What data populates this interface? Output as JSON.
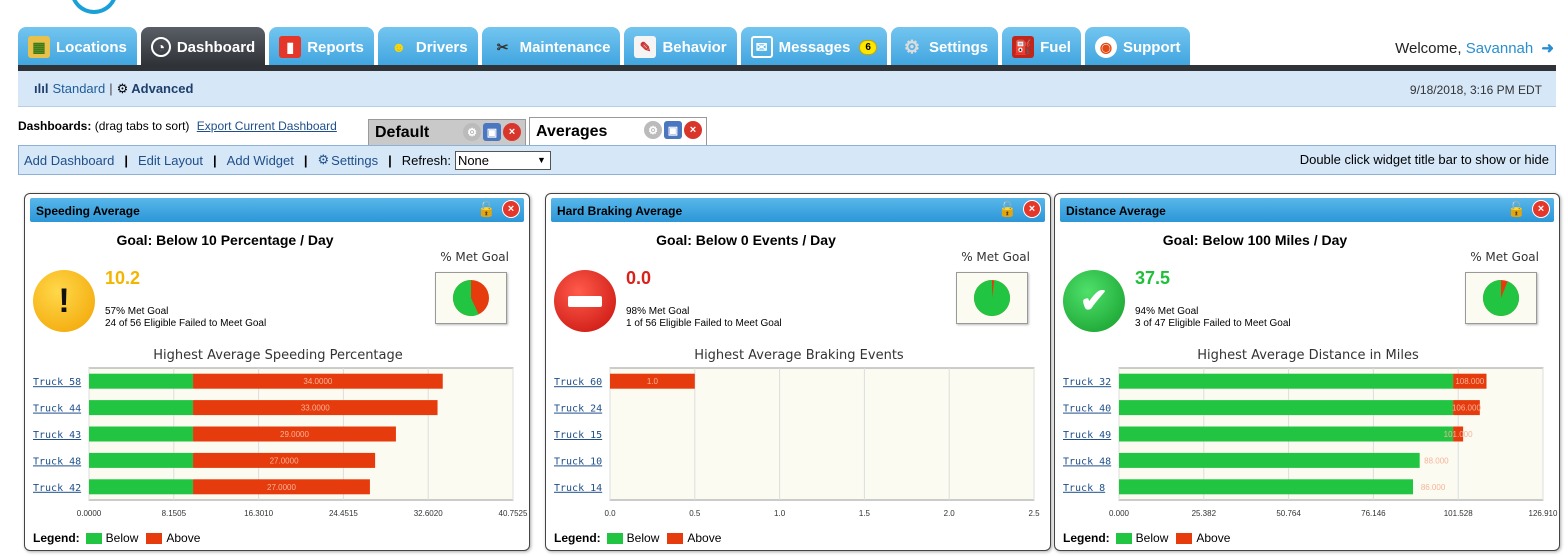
{
  "nav": {
    "tabs": [
      {
        "label": "Locations",
        "icon": "map-icon"
      },
      {
        "label": "Dashboard",
        "icon": "speedometer-icon"
      },
      {
        "label": "Reports",
        "icon": "bar-chart-icon"
      },
      {
        "label": "Drivers",
        "icon": "people-icon"
      },
      {
        "label": "Maintenance",
        "icon": "tools-icon"
      },
      {
        "label": "Behavior",
        "icon": "clipboard-icon"
      },
      {
        "label": "Messages",
        "icon": "envelope-icon",
        "badge": "6"
      },
      {
        "label": "Settings",
        "icon": "gear-icon"
      },
      {
        "label": "Fuel",
        "icon": "fuel-pump-icon"
      },
      {
        "label": "Support",
        "icon": "lifebuoy-icon"
      }
    ],
    "welcome": "Welcome,",
    "user": "Savannah",
    "logout_icon": "logout-icon"
  },
  "subbar": {
    "standard": "Standard",
    "separator": "|",
    "advanced": "Advanced",
    "datetime": "9/18/2018, 3:16 PM EDT"
  },
  "dashboards": {
    "label": "Dashboards:",
    "hint": "(drag tabs to sort)",
    "export_link": "Export Current Dashboard",
    "tabs": [
      "Default",
      "Averages"
    ]
  },
  "toolbar": {
    "add_dashboard": "Add Dashboard",
    "edit_layout": "Edit Layout",
    "add_widget": "Add Widget",
    "settings": "Settings",
    "refresh_label": "Refresh:",
    "refresh_value": "None",
    "hint": "Double click widget title bar to show or hide"
  },
  "legend": {
    "label": "Legend:",
    "below": "Below",
    "above": "Above"
  },
  "pct_met_goal": "% Met Goal",
  "widgets": [
    {
      "title": "Speeding Average",
      "goal": "Goal: Below 10 Percentage / Day",
      "value": "10.2",
      "value_color": "#f2b600",
      "status_icon": "warning-icon",
      "met": "57% Met Goal",
      "failed": "24 of 56 Eligible Failed to Meet Goal",
      "met_fraction": 0.57
    },
    {
      "title": "Hard Braking Average",
      "goal": "Goal: Below 0 Events / Day",
      "value": "0.0",
      "value_color": "#d9201a",
      "status_icon": "stop-icon",
      "met": "98% Met Goal",
      "failed": "1 of 56 Eligible Failed to Meet Goal",
      "met_fraction": 0.98
    },
    {
      "title": "Distance Average",
      "goal": "Goal: Below 100 Miles / Day",
      "value": "37.5",
      "value_color": "#1fbf3a",
      "status_icon": "checkmark-icon",
      "met": "94% Met Goal",
      "failed": "3 of 47 Eligible Failed to Meet Goal",
      "met_fraction": 0.94
    }
  ],
  "chart_data": [
    {
      "type": "bar",
      "title": "Highest Average Speeding Percentage",
      "categories": [
        "Truck 58",
        "Truck 44",
        "Truck 43",
        "Truck 48",
        "Truck 42"
      ],
      "goal": 10,
      "values": [
        34.0,
        33.5,
        29.5,
        27.5,
        27.0
      ],
      "value_labels": [
        "34.0000",
        "33.0000",
        "29.0000",
        "27.0000",
        "27.0000"
      ],
      "xlim": [
        0,
        40.7525
      ],
      "xticks": [
        "0.0000",
        "8.1505",
        "16.3010",
        "24.4515",
        "32.6020",
        "40.7525"
      ],
      "series": [
        {
          "name": "Below",
          "color": "#22c542"
        },
        {
          "name": "Above",
          "color": "#e63b0c"
        }
      ]
    },
    {
      "type": "bar",
      "title": "Highest Average Braking Events",
      "categories": [
        "Truck 60",
        "Truck 24",
        "Truck 15",
        "Truck 10",
        "Truck 14"
      ],
      "goal": 0,
      "values": [
        0.5,
        0,
        0,
        0,
        0
      ],
      "value_labels": [
        "1.0",
        "",
        "",
        "",
        ""
      ],
      "xlim": [
        0,
        2.5
      ],
      "xticks": [
        "0.0",
        "0.5",
        "1.0",
        "1.5",
        "2.0",
        "2.5"
      ],
      "series": [
        {
          "name": "Below",
          "color": "#22c542"
        },
        {
          "name": "Above",
          "color": "#e63b0c"
        }
      ]
    },
    {
      "type": "bar",
      "title": "Highest Average Distance in Miles",
      "categories": [
        "Truck 32",
        "Truck 40",
        "Truck 49",
        "Truck 48",
        "Truck 8"
      ],
      "goal": 100,
      "values": [
        110,
        108,
        103,
        90,
        88
      ],
      "value_labels": [
        "108.000",
        "106.000",
        "101.000",
        "88.000",
        "86.000"
      ],
      "xlim": [
        0,
        126.91
      ],
      "xticks": [
        "0.000",
        "25.382",
        "50.764",
        "76.146",
        "101.528",
        "126.910"
      ],
      "series": [
        {
          "name": "Below",
          "color": "#22c542"
        },
        {
          "name": "Above",
          "color": "#e63b0c"
        }
      ]
    }
  ]
}
